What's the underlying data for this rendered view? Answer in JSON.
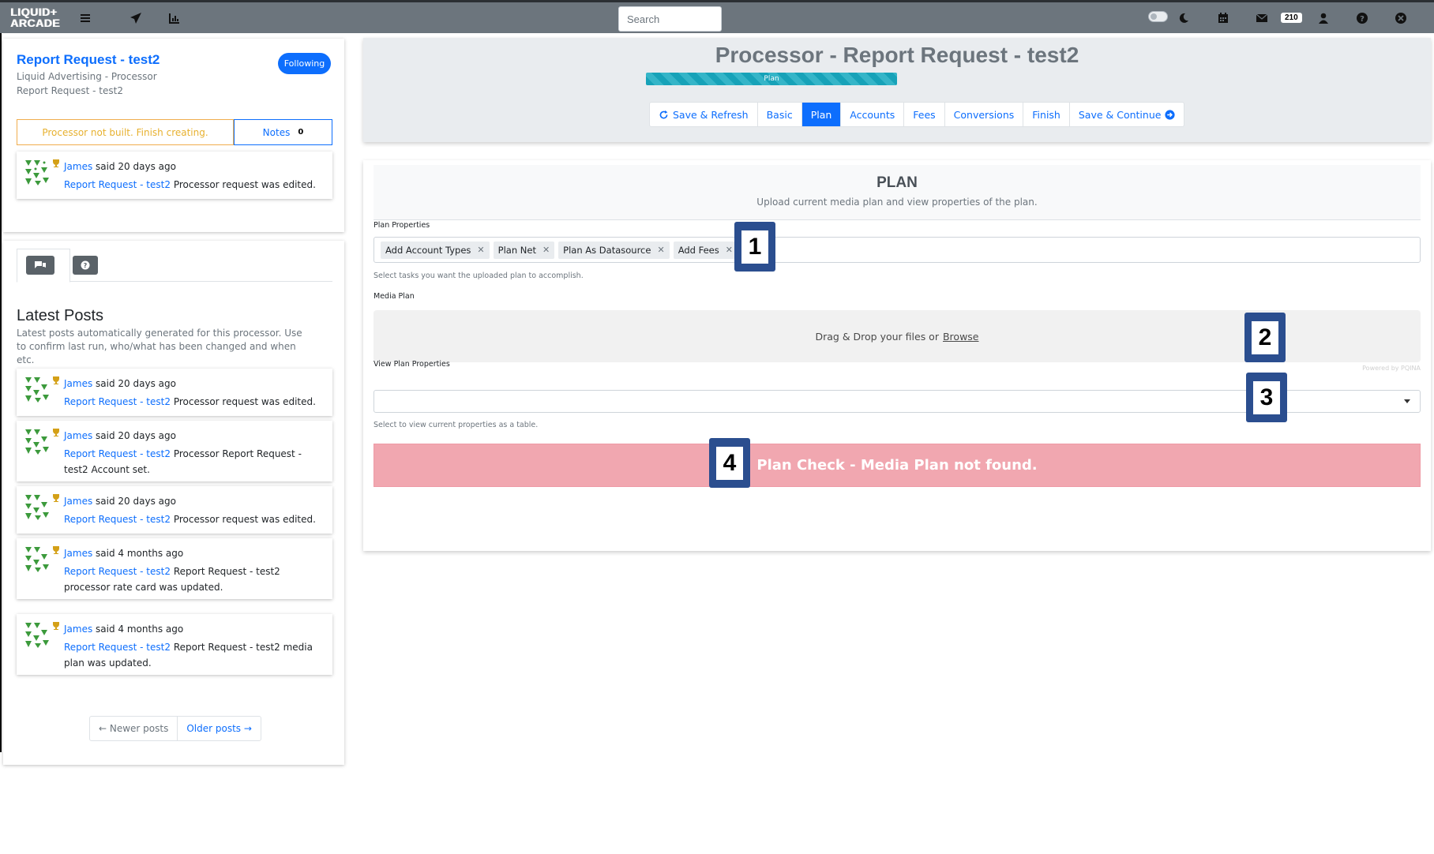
{
  "navbar": {
    "logo_line1": "LIQUID+",
    "logo_line2": "ARCADE",
    "search_placeholder": "Search",
    "messages_count": "210",
    "icons": [
      "menu-icon",
      "send-icon",
      "chart-icon",
      "toggle-switch",
      "moon-icon",
      "calendar-icon",
      "mail-icon",
      "user-icon",
      "help-icon",
      "close-icon"
    ]
  },
  "sidebar": {
    "title": "Report Request - test2",
    "subtitle1": "Liquid Advertising - Processor",
    "subtitle2": "Report Request - test2",
    "following_label": "Following",
    "status_warning": "Processor not built. Finish creating.",
    "notes_label": "Notes",
    "notes_count": "0",
    "top_post": {
      "author": "James",
      "when": "said 20 days ago",
      "link": "Report Request - test2",
      "text": "Processor request was edited."
    },
    "latest_title": "Latest Posts",
    "latest_desc": "Latest posts automatically generated for this processor. Use to confirm last run, who/what has been changed and when etc.",
    "posts": [
      {
        "author": "James",
        "when": "said 20 days ago",
        "link": "Report Request - test2",
        "text": "Processor request was edited."
      },
      {
        "author": "James",
        "when": "said 20 days ago",
        "link": "Report Request - test2",
        "text": "Processor Report Request - test2 Account set."
      },
      {
        "author": "James",
        "when": "said 20 days ago",
        "link": "Report Request - test2",
        "text": "Processor request was edited."
      },
      {
        "author": "James",
        "when": "said 4 months ago",
        "link": "Report Request - test2",
        "text": "Report Request - test2 processor rate card was updated."
      },
      {
        "author": "James",
        "when": "said 4 months ago",
        "link": "Report Request - test2",
        "text": "Report Request - test2 media plan was updated."
      }
    ],
    "pager_newer": "← Newer posts",
    "pager_older": "Older posts →"
  },
  "main": {
    "title": "Processor - Report Request - test2",
    "progress_label": "Plan",
    "progress_fraction": 1.0,
    "nav": {
      "save_refresh": "Save & Refresh",
      "basic": "Basic",
      "plan": "Plan",
      "accounts": "Accounts",
      "fees": "Fees",
      "conversions": "Conversions",
      "finish": "Finish",
      "save_continue": "Save & Continue"
    }
  },
  "plan": {
    "title": "PLAN",
    "subtitle": "Upload current media plan and view properties of the plan.",
    "properties_label": "Plan Properties",
    "tags": [
      "Add Account Types",
      "Plan Net",
      "Plan As Datasource",
      "Add Fees"
    ],
    "properties_hint": "Select tasks you want the uploaded plan to accomplish.",
    "media_plan_label": "Media Plan",
    "dropzone_text": "Drag & Drop your files or",
    "dropzone_browse": "Browse",
    "powered_by": "Powered by PQINA",
    "view_label": "View Plan Properties",
    "view_hint": "Select to view current properties as a table.",
    "alert_text": "Plan Check - Media Plan not found."
  },
  "callouts": [
    "1",
    "2",
    "3",
    "4"
  ],
  "colors": {
    "primary": "#0d6efd",
    "navbar": "#6c757d",
    "danger_bg": "#f1a7b0",
    "callout": "#2b4e8f",
    "progress": "#17a2b8"
  }
}
